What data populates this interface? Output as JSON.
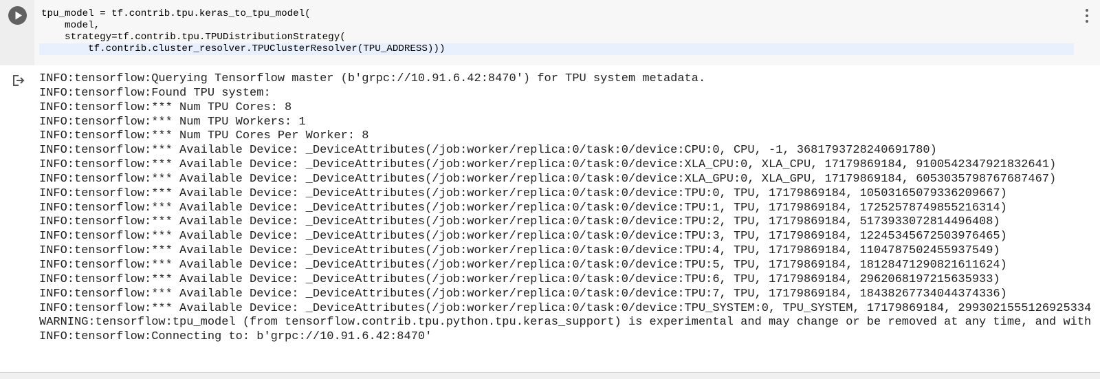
{
  "code": {
    "lines": [
      "tpu_model = tf.contrib.tpu.keras_to_tpu_model(",
      "    model,",
      "    strategy=tf.contrib.tpu.TPUDistributionStrategy(",
      "        tf.contrib.cluster_resolver.TPUClusterResolver(TPU_ADDRESS)))"
    ]
  },
  "icons": {
    "run": "play-icon",
    "menu": "more-vert-icon",
    "output": "output-redirect-icon"
  },
  "colors": {
    "input_background": "#f7f7f7",
    "gutter_background": "#eeeeee",
    "run_button": "#616161",
    "active_line": "#e8f0fe"
  },
  "output": {
    "lines": [
      "INFO:tensorflow:Querying Tensorflow master (b'grpc://10.91.6.42:8470') for TPU system metadata.",
      "INFO:tensorflow:Found TPU system:",
      "INFO:tensorflow:*** Num TPU Cores: 8",
      "INFO:tensorflow:*** Num TPU Workers: 1",
      "INFO:tensorflow:*** Num TPU Cores Per Worker: 8",
      "INFO:tensorflow:*** Available Device: _DeviceAttributes(/job:worker/replica:0/task:0/device:CPU:0, CPU, -1, 3681793728240691780)",
      "INFO:tensorflow:*** Available Device: _DeviceAttributes(/job:worker/replica:0/task:0/device:XLA_CPU:0, XLA_CPU, 17179869184, 9100542347921832641)",
      "INFO:tensorflow:*** Available Device: _DeviceAttributes(/job:worker/replica:0/task:0/device:XLA_GPU:0, XLA_GPU, 17179869184, 6053035798767687467)",
      "INFO:tensorflow:*** Available Device: _DeviceAttributes(/job:worker/replica:0/task:0/device:TPU:0, TPU, 17179869184, 10503165079336209667)",
      "INFO:tensorflow:*** Available Device: _DeviceAttributes(/job:worker/replica:0/task:0/device:TPU:1, TPU, 17179869184, 17252578749855216314)",
      "INFO:tensorflow:*** Available Device: _DeviceAttributes(/job:worker/replica:0/task:0/device:TPU:2, TPU, 17179869184, 5173933072814496408)",
      "INFO:tensorflow:*** Available Device: _DeviceAttributes(/job:worker/replica:0/task:0/device:TPU:3, TPU, 17179869184, 12245345672503976465)",
      "INFO:tensorflow:*** Available Device: _DeviceAttributes(/job:worker/replica:0/task:0/device:TPU:4, TPU, 17179869184, 1104787502455937549)",
      "INFO:tensorflow:*** Available Device: _DeviceAttributes(/job:worker/replica:0/task:0/device:TPU:5, TPU, 17179869184, 18128471290821611624)",
      "INFO:tensorflow:*** Available Device: _DeviceAttributes(/job:worker/replica:0/task:0/device:TPU:6, TPU, 17179869184, 2962068197215635933)",
      "INFO:tensorflow:*** Available Device: _DeviceAttributes(/job:worker/replica:0/task:0/device:TPU:7, TPU, 17179869184, 18438267734044374336)",
      "INFO:tensorflow:*** Available Device: _DeviceAttributes(/job:worker/replica:0/task:0/device:TPU_SYSTEM:0, TPU_SYSTEM, 17179869184, 2993021555126925334",
      "WARNING:tensorflow:tpu_model (from tensorflow.contrib.tpu.python.tpu.keras_support) is experimental and may change or be removed at any time, and with",
      "INFO:tensorflow:Connecting to: b'grpc://10.91.6.42:8470'"
    ]
  }
}
